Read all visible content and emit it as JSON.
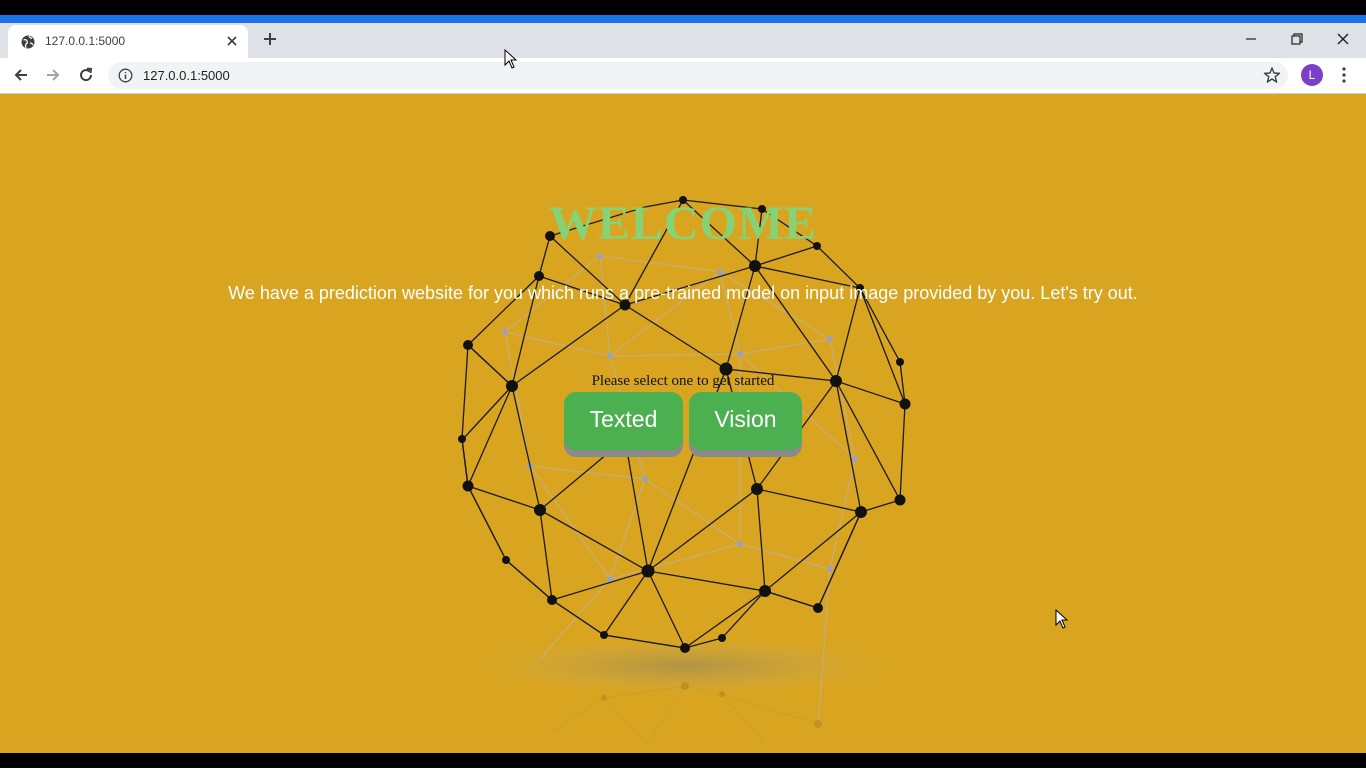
{
  "browser": {
    "tab": {
      "title": "127.0.0.1:5000"
    },
    "address_bar": {
      "url": "127.0.0.1:5000"
    },
    "profile": {
      "initial": "L",
      "color": "#7b3fc9"
    },
    "accent_color": "#1a73e8"
  },
  "page": {
    "background_color": "#d9a520",
    "title": "WELCOME",
    "subtitle": "We have a prediction website for you which runs a pre-trained model on input image provided by you. Let's try out.",
    "prompt": "Please select one to get started",
    "buttons": {
      "texted": "Texted",
      "vision": "Vision",
      "color": "#4caf50"
    }
  }
}
